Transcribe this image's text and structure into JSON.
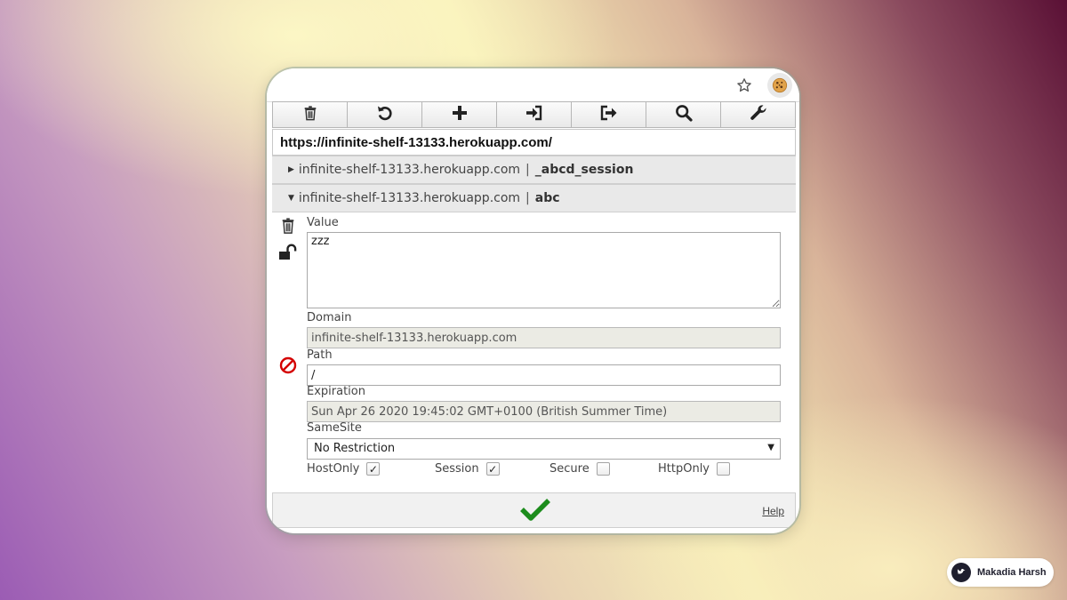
{
  "toolbar": {
    "tools": [
      {
        "icon": "trash-icon"
      },
      {
        "icon": "undo-icon"
      },
      {
        "icon": "plus-icon"
      },
      {
        "icon": "import-icon"
      },
      {
        "icon": "export-icon"
      },
      {
        "icon": "search-icon"
      },
      {
        "icon": "wrench-icon"
      }
    ]
  },
  "url": "https://infinite-shelf-13133.herokuapp.com/",
  "cookies": [
    {
      "domain": "infinite-shelf-13133.herokuapp.com",
      "separator": "|",
      "name": "_abcd_session",
      "expanded": false
    },
    {
      "domain": "infinite-shelf-13133.herokuapp.com",
      "separator": "|",
      "name": "abc",
      "expanded": true
    }
  ],
  "detail": {
    "value_label": "Value",
    "value": "zzz",
    "domain_label": "Domain",
    "domain": "infinite-shelf-13133.herokuapp.com",
    "path_label": "Path",
    "path": "/",
    "expiration_label": "Expiration",
    "expiration": "Sun Apr 26 2020 19:45:02 GMT+0100 (British Summer Time)",
    "samesite_label": "SameSite",
    "samesite": "No Restriction",
    "flags": [
      {
        "label": "HostOnly",
        "checked": true
      },
      {
        "label": "Session",
        "checked": true
      },
      {
        "label": "Secure",
        "checked": false
      },
      {
        "label": "HttpOnly",
        "checked": false
      }
    ]
  },
  "footer": {
    "help": "Help"
  },
  "badge": {
    "name": "Makadia Harsh"
  },
  "colors": {
    "accent_green": "#1c8c1c",
    "block_red": "#d40000"
  }
}
